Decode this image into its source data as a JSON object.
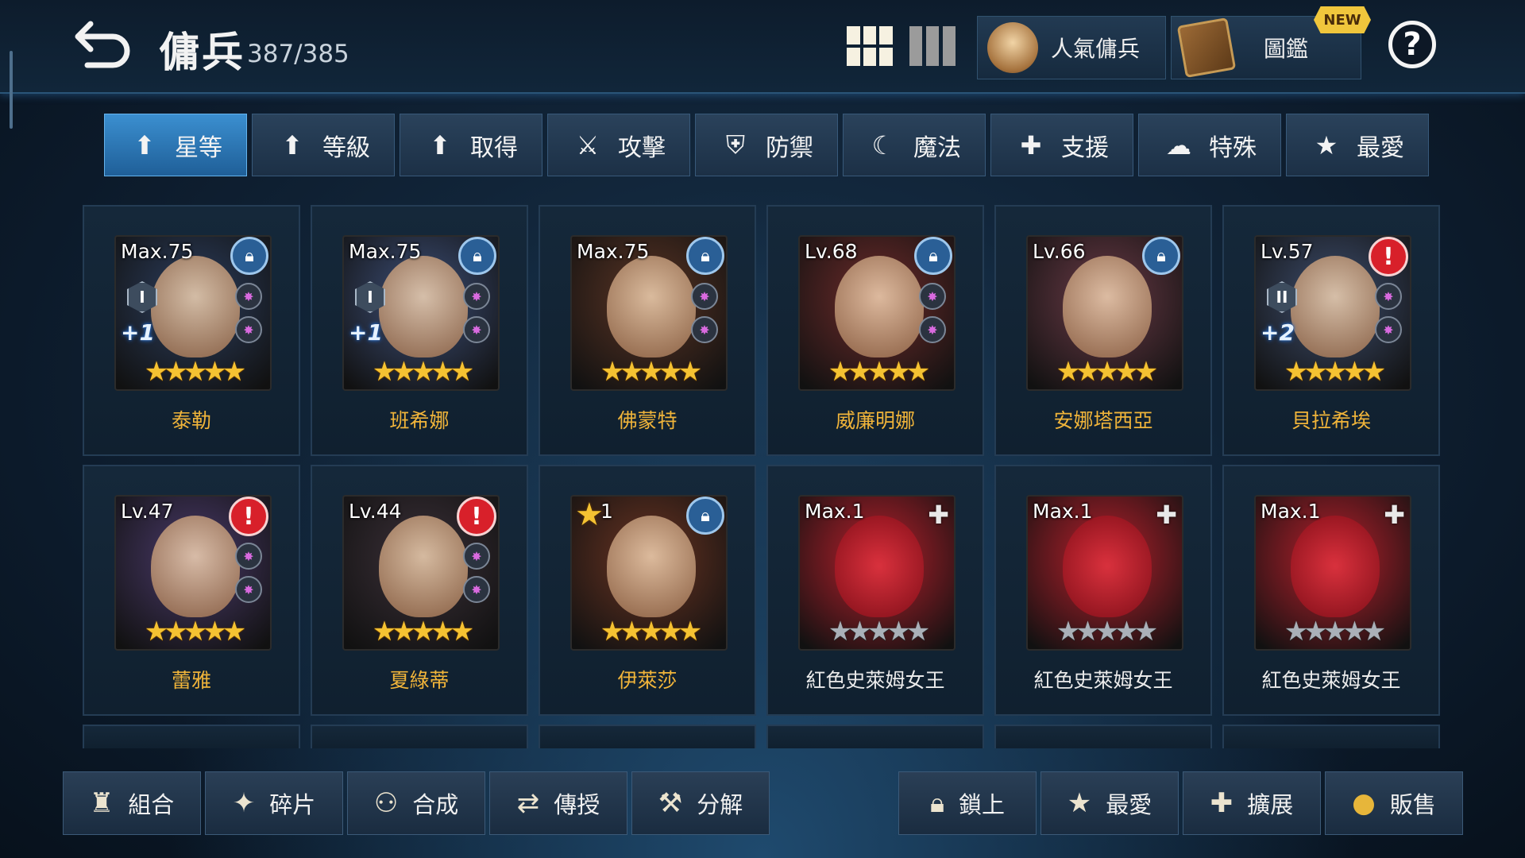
{
  "header": {
    "title": "傭兵",
    "count": "387/385",
    "popular_label": "人氣傭兵",
    "codex_label": "圖鑑",
    "new_badge": "NEW",
    "help_label": "?"
  },
  "sort_tabs": [
    {
      "label": "星等",
      "icon": "arrow-up-icon",
      "active": true
    },
    {
      "label": "等級",
      "icon": "arrow-up-icon",
      "active": false
    },
    {
      "label": "取得",
      "icon": "arrow-up-icon",
      "active": false
    },
    {
      "label": "攻擊",
      "icon": "sword-icon",
      "active": false
    },
    {
      "label": "防禦",
      "icon": "shield-icon",
      "active": false
    },
    {
      "label": "魔法",
      "icon": "magic-icon",
      "active": false
    },
    {
      "label": "支援",
      "icon": "support-icon",
      "active": false
    },
    {
      "label": "特殊",
      "icon": "special-icon",
      "active": false
    },
    {
      "label": "最愛",
      "icon": "star-icon",
      "active": false
    }
  ],
  "mercenaries": [
    {
      "name": "泰勒",
      "level": "Max.75",
      "stars": 5,
      "badge": "lock",
      "rank": "I",
      "plus": "+1",
      "gems": 2,
      "color": "#2c3e5e"
    },
    {
      "name": "班希娜",
      "level": "Max.75",
      "stars": 5,
      "badge": "lock",
      "rank": "I",
      "plus": "+1",
      "gems": 2,
      "color": "#3d4f78"
    },
    {
      "name": "佛蒙特",
      "level": "Max.75",
      "stars": 5,
      "badge": "lock",
      "rank": "",
      "plus": "",
      "gems": 2,
      "color": "#5a3424"
    },
    {
      "name": "威廉明娜",
      "level": "Lv.68",
      "stars": 5,
      "badge": "lock",
      "rank": "",
      "plus": "",
      "gems": 2,
      "color": "#6e2b2a"
    },
    {
      "name": "安娜塔西亞",
      "level": "Lv.66",
      "stars": 5,
      "badge": "lock",
      "rank": "",
      "plus": "",
      "gems": 0,
      "color": "#6a3a46"
    },
    {
      "name": "貝拉希埃",
      "level": "Lv.57",
      "stars": 5,
      "badge": "alert",
      "rank": "II",
      "plus": "+2",
      "gems": 2,
      "color": "#3e4e6e"
    },
    {
      "name": "蕾雅",
      "level": "Lv.47",
      "stars": 5,
      "badge": "alert",
      "rank": "",
      "plus": "",
      "gems": 2,
      "color": "#4a3a6a"
    },
    {
      "name": "夏綠蒂",
      "level": "Lv.44",
      "stars": 5,
      "badge": "alert",
      "rank": "",
      "plus": "",
      "gems": 2,
      "color": "#3b3038"
    },
    {
      "name": "伊萊莎",
      "level": "1",
      "stars": 5,
      "badge": "lock",
      "rank": "",
      "plus": "",
      "gems": 0,
      "corner_star": true,
      "color": "#6a3422"
    },
    {
      "name": "紅色史萊姆女王",
      "level": "Max.1",
      "stars": 5,
      "badge": "support",
      "grey": true,
      "rank": "",
      "plus": "",
      "gems": 0,
      "color": "#b8202c"
    },
    {
      "name": "紅色史萊姆女王",
      "level": "Max.1",
      "stars": 5,
      "badge": "support",
      "grey": true,
      "rank": "",
      "plus": "",
      "gems": 0,
      "color": "#b8202c"
    },
    {
      "name": "紅色史萊姆女王",
      "level": "Max.1",
      "stars": 5,
      "badge": "support",
      "grey": true,
      "rank": "",
      "plus": "",
      "gems": 0,
      "color": "#b8202c"
    }
  ],
  "bottom_left": [
    {
      "label": "組合",
      "icon": "team-icon"
    },
    {
      "label": "碎片",
      "icon": "shards-icon"
    },
    {
      "label": "合成",
      "icon": "combine-icon"
    },
    {
      "label": "傳授",
      "icon": "transfer-icon"
    },
    {
      "label": "分解",
      "icon": "hammer-icon"
    }
  ],
  "bottom_right": [
    {
      "label": "鎖上",
      "icon": "lock-icon"
    },
    {
      "label": "最愛",
      "icon": "star-icon"
    },
    {
      "label": "擴展",
      "icon": "plus-icon"
    },
    {
      "label": "販售",
      "icon": "coin-icon"
    }
  ],
  "colors": {
    "accent": "#3b8fd0",
    "name_gold": "#f0b43a",
    "alert_red": "#d8202a"
  }
}
